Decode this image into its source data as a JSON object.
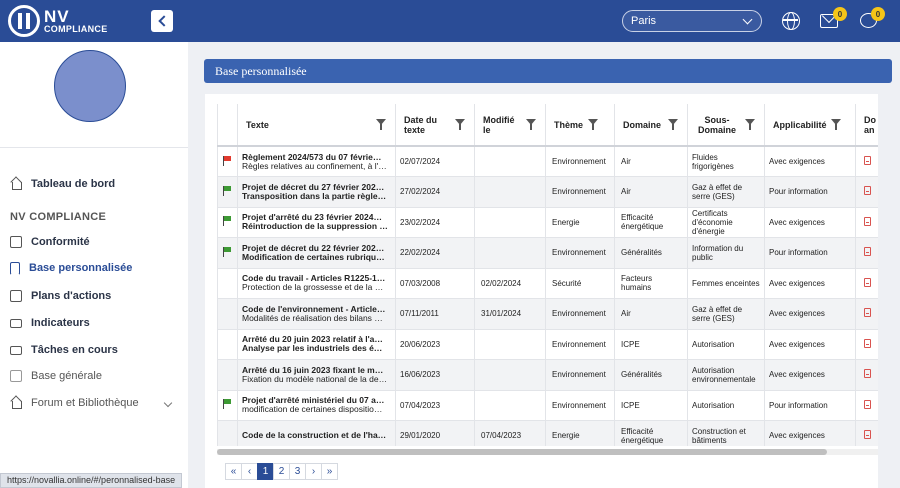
{
  "header": {
    "logo_text": "NV",
    "logo_sub": "COMPLIANCE",
    "city": "Paris",
    "mail_badge": "0",
    "chat_badge": "0"
  },
  "sidebar": {
    "items_top": [
      {
        "label": "Tableau de bord",
        "icon": "home-icon"
      }
    ],
    "section": "NV COMPLIANCE",
    "items": [
      {
        "label": "Conformité",
        "icon": "checkbox-icon"
      },
      {
        "label": "Base personnalisée",
        "icon": "bookmark-icon"
      },
      {
        "label": "Plans d'actions",
        "icon": "external-link-icon"
      },
      {
        "label": "Indicateurs",
        "icon": "indicator-icon"
      },
      {
        "label": "Tâches en cours",
        "icon": "tasks-icon"
      },
      {
        "label": "Base générale",
        "icon": "grid-icon"
      },
      {
        "label": "Forum et Bibliothèque",
        "icon": "library-icon"
      }
    ]
  },
  "status_url": "https://novallia.online/#/peronnalised-base",
  "page_title": "Base personnalisée",
  "table": {
    "columns": [
      "Texte",
      "Date du texte",
      "Modifié le",
      "Thème",
      "Domaine",
      "Sous-Domaine",
      "Applicabilité",
      "Do an"
    ],
    "rows": [
      {
        "flag": "red",
        "t1": "Règlement 2024/573 du 07 févrie…",
        "t2": "Règles relatives au confinement, à l'…",
        "t2_bold": false,
        "date": "02/07/2024",
        "modifie": "",
        "theme": "Environnement",
        "domaine": "Air",
        "sous_domaine": "Fluides frigorigènes",
        "applicabilite": "Avec exigences"
      },
      {
        "flag": "green",
        "t1": "Projet de décret du 27 février 202…",
        "t2": "Transposition dans la partie règle…",
        "t2_bold": true,
        "date": "27/02/2024",
        "modifie": "",
        "theme": "Environnement",
        "domaine": "Air",
        "sous_domaine": "Gaz à effet de serre (GES)",
        "applicabilite": "Pour information"
      },
      {
        "flag": "green",
        "t1": "Projet d'arrêté du 23 février 2024…",
        "t2": "Réintroduction de la suppression …",
        "t2_bold": true,
        "date": "23/02/2024",
        "modifie": "",
        "theme": "Energie",
        "domaine": "Efficacité énergétique",
        "sous_domaine": "Certificats d'économie d'énergie",
        "applicabilite": "Avec exigences"
      },
      {
        "flag": "green",
        "t1": "Projet de décret du 22 février 202…",
        "t2": "Modification de certaines rubriqu…",
        "t2_bold": true,
        "date": "22/02/2024",
        "modifie": "",
        "theme": "Environnement",
        "domaine": "Généralités",
        "sous_domaine": "Information du public",
        "applicabilite": "Pour information"
      },
      {
        "flag": "",
        "t1": "Code du travail - Articles R1225-1…",
        "t2": "Protection de la grossesse et de la …",
        "t2_bold": false,
        "date": "07/03/2008",
        "modifie": "02/02/2024",
        "theme": "Sécurité",
        "domaine": "Facteurs humains",
        "sous_domaine": "Femmes enceintes",
        "applicabilite": "Avec exigences"
      },
      {
        "flag": "",
        "t1": "Code de l'environnement - Article…",
        "t2": "Modalités de réalisation des bilans …",
        "t2_bold": false,
        "date": "07/11/2011",
        "modifie": "31/01/2024",
        "theme": "Environnement",
        "domaine": "Air",
        "sous_domaine": "Gaz à effet de serre (GES)",
        "applicabilite": "Avec exigences"
      },
      {
        "flag": "",
        "t1": "Arrêté du 20 juin 2023 relatif à l'a…",
        "t2": "Analyse par les industriels des é…",
        "t2_bold": true,
        "date": "20/06/2023",
        "modifie": "",
        "theme": "Environnement",
        "domaine": "ICPE",
        "sous_domaine": "Autorisation",
        "applicabilite": "Avec exigences"
      },
      {
        "flag": "",
        "t1": "Arrêté du 16 juin 2023 fixant le m…",
        "t2": "Fixation du modèle national de la de…",
        "t2_bold": false,
        "date": "16/06/2023",
        "modifie": "",
        "theme": "Environnement",
        "domaine": "Généralités",
        "sous_domaine": "Autorisation environnementale",
        "applicabilite": "Avec exigences"
      },
      {
        "flag": "green",
        "t1": "Projet d'arrêté ministériel du 07 a…",
        "t2": "modification de certaines dispositio…",
        "t2_bold": false,
        "date": "07/04/2023",
        "modifie": "",
        "theme": "Environnement",
        "domaine": "ICPE",
        "sous_domaine": "Autorisation",
        "applicabilite": "Pour information"
      },
      {
        "flag": "",
        "t1": "Code de la construction et de l'ha…",
        "t2": "",
        "t2_bold": false,
        "date": "29/01/2020",
        "modifie": "07/04/2023",
        "theme": "Energie",
        "domaine": "Efficacité énergétique",
        "sous_domaine": "Construction et bâtiments",
        "applicabilite": "Avec exigences"
      }
    ]
  },
  "pagination": {
    "first": "«",
    "prev": "‹",
    "pages": [
      "1",
      "2",
      "3"
    ],
    "active": "1",
    "next": "›",
    "last": "»"
  }
}
